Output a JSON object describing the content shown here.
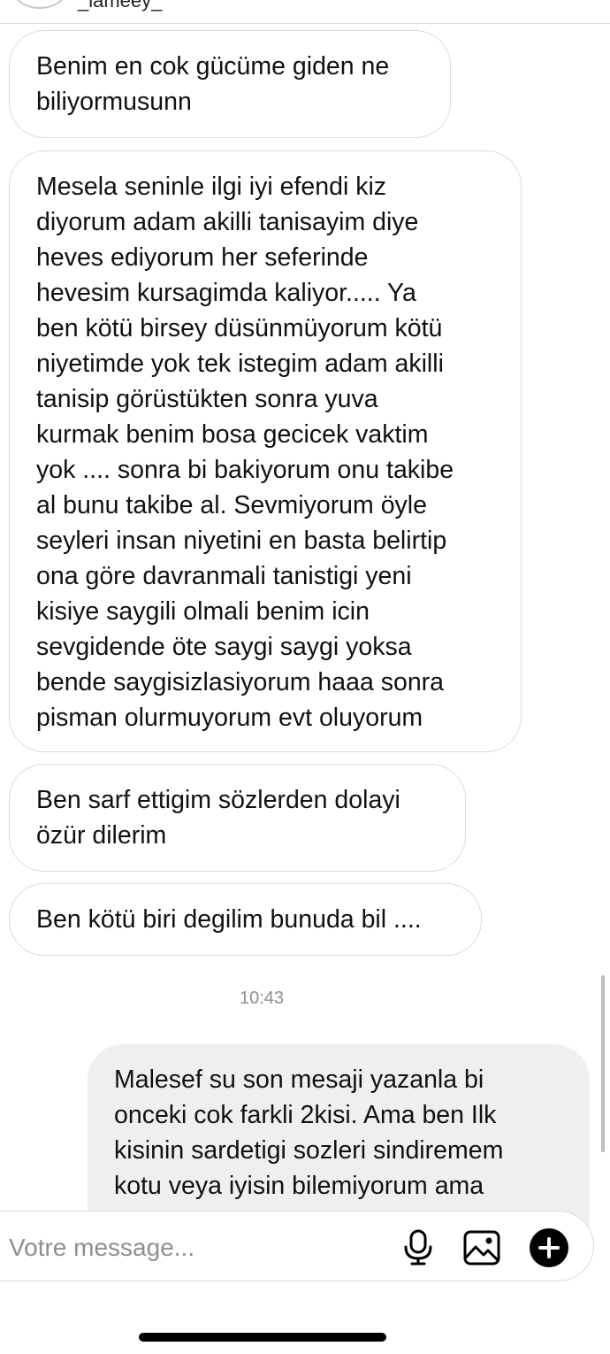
{
  "header": {
    "username": "_lameey_"
  },
  "messages": {
    "incoming": [
      {
        "lines": [
          "Benim en cok gücüme giden ne",
          "biliyormusunn"
        ]
      },
      {
        "lines": [
          "Mesela seninle ilgi iyi efendi kiz",
          "diyorum adam akilli tanisayim diye",
          "heves ediyorum her seferinde",
          "hevesim kursagimda kaliyor..... Ya",
          "ben kötü birsey düsünmüyorum kötü",
          "niyetimde yok tek istegim adam akilli",
          "tanisip görüstükten sonra yuva",
          "kurmak benim bosa gecicek vaktim",
          "yok .... sonra bi bakiyorum onu takibe",
          "al bunu takibe al. Sevmiyorum öyle",
          "seyleri insan niyetini en basta belirtip",
          "ona göre davranmali tanistigi yeni",
          "kisiye saygili olmali benim icin",
          "sevgidende öte saygi saygi yoksa",
          "bende saygisizlasiyorum haaa sonra",
          "pisman olurmuyorum evt oluyorum"
        ]
      },
      {
        "lines": [
          "Ben sarf ettigim sözlerden dolayi",
          "özür dilerim"
        ]
      },
      {
        "lines": [
          "Ben kötü biri degilim bunuda bil ...."
        ]
      }
    ],
    "timestamp": "10:43",
    "outgoing": {
      "lines": [
        "Malesef su son mesaji yazanla bi",
        "onceki cok farkli 2kisi. Ama ben Ilk",
        "kisinin sardetigi sozleri sindiremem",
        "kotu veya iyisin bilemiyorum ama"
      ]
    }
  },
  "composer": {
    "placeholder": "Votre message...",
    "icons": {
      "mic": "microphone-icon",
      "gallery": "image-gallery-icon",
      "plus": "plus-circle-icon"
    }
  },
  "colors": {
    "bubble_border": "#dbdbdb",
    "outgoing_bg": "#efefef",
    "muted_text": "#8e8e8e"
  }
}
